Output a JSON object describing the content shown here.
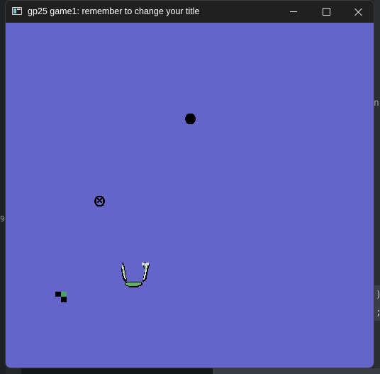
{
  "window": {
    "title": "gp25 game1: remember to change your title",
    "controls": {
      "minimize": "minimize",
      "maximize": "maximize",
      "close": "close"
    }
  },
  "game": {
    "background_color": "#6564c8",
    "sprites": [
      {
        "name": "black-ball",
        "icon": "black-circle"
      },
      {
        "name": "crossed-ball",
        "icon": "circled-x"
      },
      {
        "name": "player-crab-ship",
        "icon": "green-crab-with-claws"
      },
      {
        "name": "small-pickup",
        "icon": "black-and-green-pixel-cluster"
      }
    ]
  },
  "background_app": {
    "glyphs": [
      {
        "text": "n"
      },
      {
        "text": "9"
      },
      {
        "text": ")"
      },
      {
        "text": ";"
      }
    ]
  },
  "colors": {
    "titlebar": "#202020",
    "title_text": "#ffffff",
    "canvas": "#6564c8",
    "player_green": "#5fb068",
    "claw_light": "#d9e8d2",
    "claw_shade": "#8fb79b",
    "sprite_black": "#000000",
    "pickup_green": "#4aa06a"
  }
}
